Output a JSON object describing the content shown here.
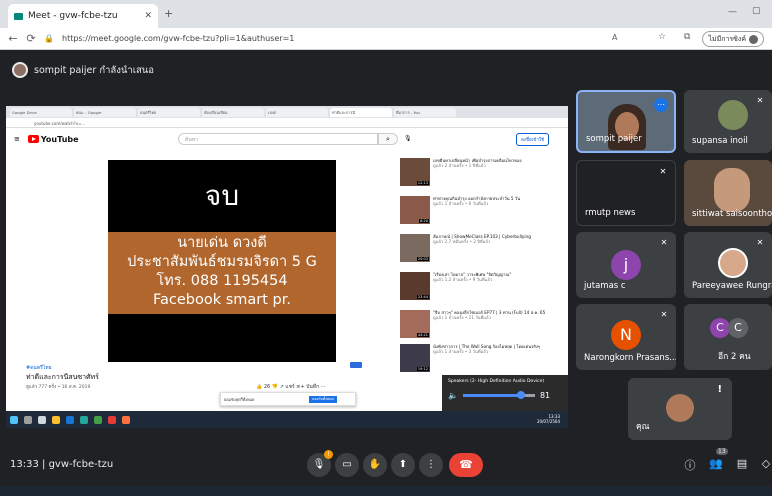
{
  "browser": {
    "tab_title": "Meet - gvw-fcbe-tzu",
    "url": "https://meet.google.com/gvw-fcbe-tzu?pli=1&authuser=1",
    "profile_label": "ไม่มีการซิงค์",
    "icons": [
      "back-icon",
      "reload-icon",
      "lock-icon",
      "read-aloud-icon",
      "favorites-icon",
      "collections-icon"
    ]
  },
  "meet": {
    "presenter_banner": "sompit paijer กำลังนำเสนอ",
    "meeting_time": "13:33",
    "meeting_code": "gvw-fcbe-tzu",
    "people_badge": "13"
  },
  "shared_screen": {
    "inner_url": "youtube.com/watch?v=...",
    "youtube": {
      "logo_text": "YouTube",
      "search_placeholder": "ค้นหา",
      "sign_in": "ลงชื่อเข้าใช้"
    },
    "video": {
      "title": "จบ",
      "lines": [
        "นายเด่น ดวงดี",
        "ประชาสัมพันธ์ชมรมจิรดา 5 G",
        "โทร. 088 1195454",
        "Facebook smart pr."
      ]
    },
    "below_video": {
      "hashtag": "#ดนตรีไทย",
      "title": "ท่าดีและการนีสนซาศัทร์",
      "meta": "ดูแล้ว 777 ครั้ง • 16 ส.ค. 2019",
      "actions": "👍 26   👎   ↗ แชร์   ≡+ บันทึก   ⋯"
    },
    "cookie_text": "ยอมรับคุกกี้ทั้งหมด",
    "cookie_button": "ยอมรับทั้งหมด",
    "speaker": {
      "device": "Speakers (2- High Definition Audio Device)",
      "volume": "81",
      "volume_fraction": 0.81
    },
    "taskbar_time": "13:33",
    "taskbar_date": "20/07/2564",
    "recommendations": [
      {
        "title": "เลขยืนหาเปลี่ยนหน้า เพื่อบำรุงการเคลื่อนไหวของ",
        "meta": "ดูแล้ว 2 ล้านครั้ง • 1 ปีที่แล้ว",
        "dur": "12:13"
      },
      {
        "title": "ท่าทางคุณกินบำรุง ออกกำลังกายประจำวัน 5 วัน",
        "meta": "ดูแล้ว 1 ล้านครั้ง • 6 วันที่แล้ว",
        "dur": "8:20"
      },
      {
        "title": "สัมภาษณ์ | ShowMeClass EP.103 | Cyberbullying",
        "meta": "ดูแล้ว 2.7 หมื่นครั้ง • 2 ปีที่แล้ว",
        "dur": "20:03"
      },
      {
        "title": "\"เรื่องเล่า ไดอาล\" วาระพิเศษ \"จิตวิญญาณ\"",
        "meta": "ดูแล้ว 1.2 ล้านครั้ง • 9 วันที่แล้ว",
        "dur": "23:44"
      },
      {
        "title": "\"จีบ สาวๆ\" คลองลึกไซเบอร์ EP77 | 3 ท่าน (Full) 14 ส.ค. 65",
        "meta": "ดูแล้ว 1 ล้านครั้ง • 11 วันที่แล้ว",
        "dur": "44:21"
      },
      {
        "title": "นั่งฟังข่าวการ | The Wall Song ร้องไม่หยุด | โดดเด่นจริงๆ",
        "meta": "ดูแล้ว 1 ล้านครั้ง • 3 วันที่แล้ว",
        "dur": "19:12"
      }
    ]
  },
  "participants": [
    {
      "name": "sompit paijer",
      "bg": "#5d6b78"
    },
    {
      "name": "supansa inoil",
      "bg": "#3c4043"
    },
    {
      "name": "rmutp news",
      "bg": "#202124"
    },
    {
      "name": "sittiwat saisoonthorn",
      "bg": "#5a4a3e"
    },
    {
      "name": "jutamas c",
      "initial": "j",
      "color": "#8e44ad"
    },
    {
      "name": "Pareeyawee Rungrat...",
      "bg": "#3c4043"
    },
    {
      "name": "Narongkorn Prasans...",
      "initial": "N",
      "color": "#e65100"
    },
    {
      "name": "อีก 2 คน",
      "initials": [
        "C",
        "C"
      ]
    }
  ],
  "self_tile": {
    "name": "คุณ"
  },
  "colors": {
    "end_call": "#ea4335",
    "meet_bg": "#202124",
    "tile": "#3c4043",
    "active_border": "#8ab4f8"
  }
}
